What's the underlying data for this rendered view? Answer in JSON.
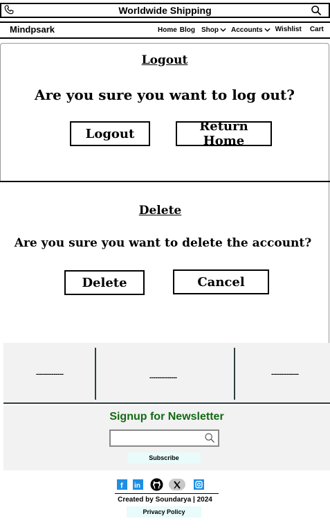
{
  "topbar": {
    "shipping_text": "Worldwide Shipping",
    "phone_icon": "phone-icon",
    "search_icon": "search-icon"
  },
  "nav": {
    "brand": "Mindpsark",
    "links": {
      "home": "Home",
      "blog": "Blog",
      "shop": "Shop",
      "accounts": "Accounts",
      "wishlist": "Wishlist",
      "cart": "Cart"
    }
  },
  "logout": {
    "heading": "Logout",
    "question": "Are you sure you want to log out?",
    "confirm_label": "Logout",
    "home_label": "Return Home"
  },
  "delete": {
    "heading": "Delete",
    "question": "Are you sure you want to delete the account?",
    "confirm_label": "Delete",
    "cancel_label": "Cancel"
  },
  "footer": {
    "columns": [
      "--------------",
      "--------------",
      "--------------"
    ],
    "newsletter": {
      "title": "Signup for Newsletter",
      "placeholder": "",
      "subscribe_label": "Subscribe",
      "title_color": "#146914"
    },
    "socials": [
      "facebook-icon",
      "linkedin-icon",
      "github-icon",
      "x-icon",
      "instagram-icon"
    ],
    "credit": "Created by Soundarya | 2024",
    "privacy": "Privacy Policy"
  }
}
